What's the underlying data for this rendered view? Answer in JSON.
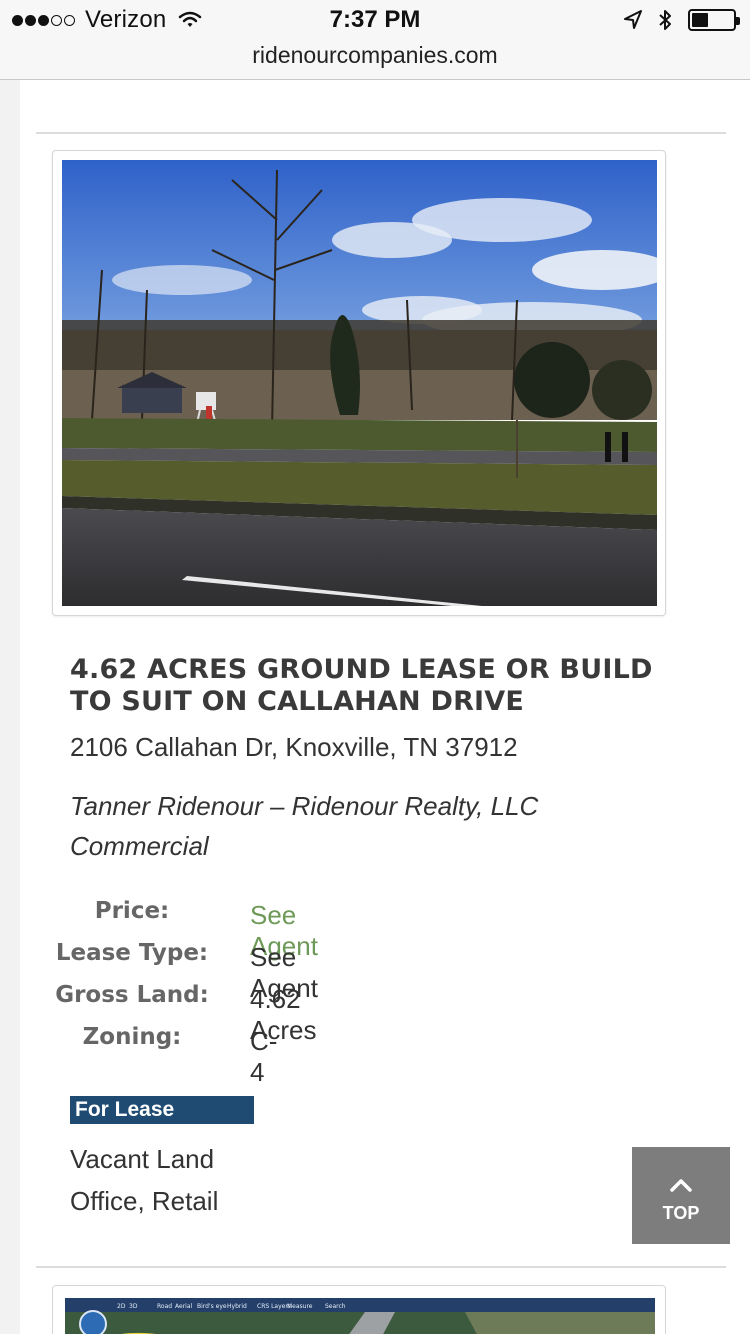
{
  "status_bar": {
    "carrier": "Verizon",
    "time": "7:37 PM",
    "battery_percent": 40
  },
  "browser": {
    "url": "ridenourcompanies.com"
  },
  "listing": {
    "title": "4.62 ACRES GROUND LEASE OR BUILD TO SUIT ON CALLAHAN DRIVE",
    "address": "2106 Callahan Dr, Knoxville, TN 37912",
    "agent": "Tanner Ridenour – Ridenour Realty, LLC",
    "category": "Commercial",
    "details": [
      {
        "label": "Price:",
        "value": "See Agent",
        "value_color": "#6e9a59"
      },
      {
        "label": "Lease Type:",
        "value": "See Agent"
      },
      {
        "label": "Gross Land:",
        "value": "4.62 Acres"
      },
      {
        "label": "Zoning:",
        "value": "C-4"
      }
    ],
    "badge": "For Lease",
    "property_types": [
      "Vacant Land",
      "Office, Retail"
    ]
  },
  "map_toolbar": [
    "2D",
    "3D",
    "Road",
    "Aerial",
    "Bird's eye",
    "Hybrid",
    "CRS Layers",
    "Measure",
    "Search"
  ],
  "top_button": {
    "label": "TOP"
  },
  "colors": {
    "badge_bg": "#1f4b73",
    "price_green": "#6e9a59",
    "top_button_bg": "#7d7d7d"
  }
}
